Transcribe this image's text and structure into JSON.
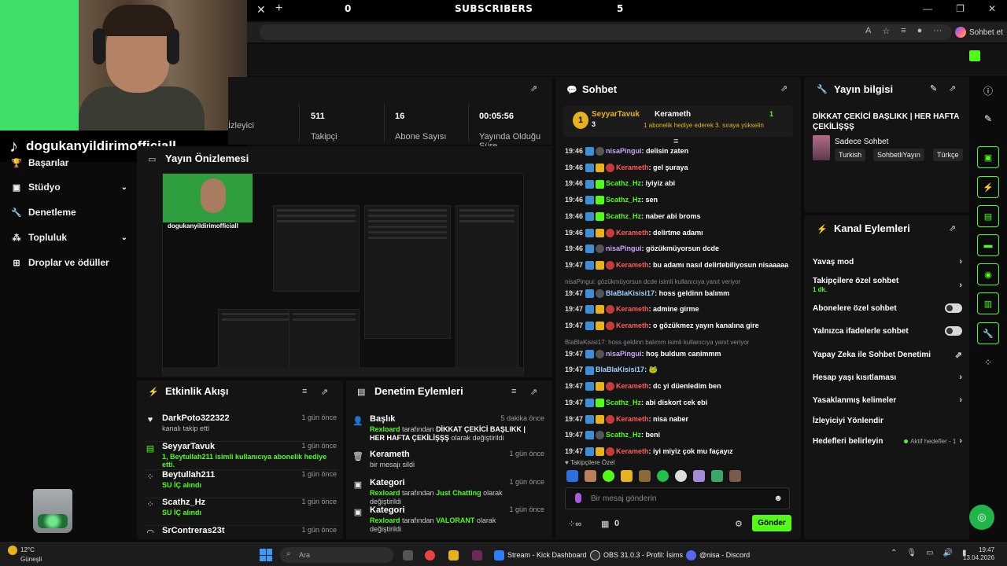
{
  "browser": {
    "close_glyph": "✕",
    "plus_glyph": "+",
    "bar_left_value": "0",
    "bar_title": "SUBSCRIBERS",
    "bar_right_value": "5",
    "controls": [
      "—",
      "❐",
      "✕"
    ],
    "copilot_label": "Sohbet et"
  },
  "webcam": {
    "handle": "dogukanyildirimofficiall"
  },
  "sidebar": {
    "items": [
      {
        "label": "Başarılar",
        "icon": "trophy-icon",
        "chevron": false
      },
      {
        "label": "Stüdyo",
        "icon": "studio-icon",
        "chevron": true
      },
      {
        "label": "Denetleme",
        "icon": "wrench-icon",
        "chevron": false
      },
      {
        "label": "Topluluk",
        "icon": "community-icon",
        "chevron": true
      },
      {
        "label": "Droplar ve ödüller",
        "icon": "gift-icon",
        "chevron": false
      }
    ]
  },
  "stats": {
    "cells": [
      {
        "value": "",
        "label": "İzleyici"
      },
      {
        "value": "511",
        "label": "Takipçi"
      },
      {
        "value": "16",
        "label": "Abone Sayısı"
      },
      {
        "value": "00:05:56",
        "label": "Yayında Olduğu Süre"
      }
    ]
  },
  "preview": {
    "title": "Yayın Önizlemesi",
    "inner_handle": "dogukanyildirimofficiall"
  },
  "activity": {
    "title": "Etkinlik Akışı",
    "items": [
      {
        "icon": "heart-icon",
        "name": "DarkPoto322322",
        "time": "1 gün önce",
        "sub": "kanalı takip etti",
        "sub_green": false
      },
      {
        "icon": "gift-icon",
        "name": "SeyyarTavuk",
        "time": "1 gün önce",
        "sub": "1, Beytullah211 isimli kullanıcıya abonelik hediye etti.",
        "sub_green": true
      },
      {
        "icon": "points-icon",
        "name": "Beytullah211",
        "time": "1 gün önce",
        "sub": "SU İÇ alındı",
        "sub_green": true
      },
      {
        "icon": "points-icon",
        "name": "Scathz_Hz",
        "time": "1 gün önce",
        "sub": "SU İÇ alındı",
        "sub_green": true
      },
      {
        "icon": "hat-icon",
        "name": "SrContreras23t",
        "time": "1 gün önce",
        "sub": "",
        "sub_green": false
      }
    ]
  },
  "moderation": {
    "title": "Denetim Eylemleri",
    "items": [
      {
        "icon": "user-edit-icon",
        "name": "Başlık",
        "time": "5 dakika önce",
        "by": "Rexloard",
        "mid": " tarafından ",
        "value": "DİKKAT ÇEKİCİ BAŞLIKK | HER HAFTA ÇEKİLİŞŞŞ",
        "tail": " olarak değiştirildi"
      },
      {
        "icon": "trash-icon",
        "name": "Kerameth",
        "time": "1 gün önce",
        "by": "",
        "mid": "bir mesajı sildi",
        "value": "",
        "tail": ""
      },
      {
        "icon": "category-icon",
        "name": "Kategori",
        "time": "1 gün önce",
        "by": "Rexloard",
        "mid": " tarafından ",
        "value": "Just Chatting",
        "tail": " olarak değiştirildi"
      },
      {
        "icon": "category-icon",
        "name": "Kategori",
        "time": "1 gün önce",
        "by": "Rexloard",
        "mid": " tarafından ",
        "value": "VALORANT",
        "tail": " olarak değiştirildi"
      }
    ]
  },
  "chat": {
    "title": "Sohbet",
    "pinned": {
      "user": "SeyyarTavuk",
      "count": "3",
      "mention": "Kerameth",
      "note": "1 abonelik hediye ederek 3. sıraya yükselin",
      "right_count": "1"
    },
    "messages": [
      {
        "time": "19:46",
        "badges": [
          "b1",
          "b4"
        ],
        "user": "nisaPingui",
        "color": "#c7a6ff",
        "text": "delisin zaten"
      },
      {
        "time": "19:46",
        "badges": [
          "b1",
          "b2",
          "b5"
        ],
        "user": "Kerameth",
        "color": "#ff5a5a",
        "text": "gel şuraya"
      },
      {
        "time": "19:46",
        "badges": [
          "b1",
          "b3"
        ],
        "user": "Scathz_Hz",
        "color": "#53fc18",
        "text": "iyiyiz abi"
      },
      {
        "time": "19:46",
        "badges": [
          "b1",
          "b3"
        ],
        "user": "Scathz_Hz",
        "color": "#53fc18",
        "text": "sen"
      },
      {
        "time": "19:46",
        "badges": [
          "b1",
          "b3"
        ],
        "user": "Scathz_Hz",
        "color": "#53fc18",
        "text": "naber abi broms"
      },
      {
        "time": "19:46",
        "badges": [
          "b1",
          "b2",
          "b5"
        ],
        "user": "Kerameth",
        "color": "#ff5a5a",
        "text": "delirtme adamı"
      },
      {
        "time": "19:46",
        "badges": [
          "b1",
          "b4"
        ],
        "user": "nisaPingui",
        "color": "#c7a6ff",
        "text": "gözükmüyorsun dcde"
      },
      {
        "time": "19:47",
        "badges": [
          "b1",
          "b2",
          "b5"
        ],
        "user": "Kerameth",
        "color": "#ff5a5a",
        "text": "bu adamı nasıl delirtebiliyosun nisaaaaa"
      },
      {
        "reply": "nisaPingui: gözükmüyorsun dcde isimli kullanıcıya yanıt veriyor"
      },
      {
        "time": "19:47",
        "badges": [
          "b1",
          "b4"
        ],
        "user": "BlaBlaKisisi17",
        "color": "#9fd0ff",
        "text": "hoss geldinn balımm"
      },
      {
        "time": "19:47",
        "badges": [
          "b1",
          "b2",
          "b5"
        ],
        "user": "Kerameth",
        "color": "#ff5a5a",
        "text": "admine girme"
      },
      {
        "time": "19:47",
        "badges": [
          "b1",
          "b2",
          "b5"
        ],
        "user": "Kerameth",
        "color": "#ff5a5a",
        "text": "o gözükmez yayın kanalına gire"
      },
      {
        "reply": "BlaBlaKisisi17: hoss geldinn balımm isimli kullanıcıya yanıt veriyor"
      },
      {
        "time": "19:47",
        "badges": [
          "b1",
          "b4"
        ],
        "user": "nisaPingui",
        "color": "#c7a6ff",
        "text": "hoş buldum canimmm"
      },
      {
        "time": "19:47",
        "badges": [
          "b1"
        ],
        "user": "BlaBlaKisisi17",
        "color": "#9fd0ff",
        "text": "🐸"
      },
      {
        "time": "19:47",
        "badges": [
          "b1",
          "b2",
          "b5"
        ],
        "user": "Kerameth",
        "color": "#ff5a5a",
        "text": "dc yi düenledim ben"
      },
      {
        "time": "19:47",
        "badges": [
          "b1",
          "b3"
        ],
        "user": "Scathz_Hz",
        "color": "#53fc18",
        "text": "abi diskort cek ebi"
      },
      {
        "time": "19:47",
        "badges": [
          "b1",
          "b2",
          "b5"
        ],
        "user": "Kerameth",
        "color": "#ff5a5a",
        "text": "nisa naber"
      },
      {
        "time": "19:47",
        "badges": [
          "b1",
          "b4"
        ],
        "user": "Scathz_Hz",
        "color": "#53fc18",
        "text": "beni"
      },
      {
        "time": "19:47",
        "badges": [
          "b1",
          "b2",
          "b5"
        ],
        "user": "Kerameth",
        "color": "#ff5a5a",
        "text": "iyi miyiz çok mu façayız"
      }
    ],
    "follow_only": "Takipçilere Özel",
    "input_placeholder": "Bir mesaj gönderin",
    "points_count": "0",
    "send_label": "Gönder"
  },
  "info": {
    "title": "Yayın bilgisi",
    "stream_title": "DİKKAT ÇEKİCİ BAŞLIKK | HER HAFTA ÇEKİLİŞŞŞ",
    "category": "Sadece Sohbet",
    "tags": [
      "Turkish",
      "SohbetliYayın",
      "Türkçe"
    ]
  },
  "actions": {
    "title": "Kanal Eylemleri",
    "slow_mode": "Yavaş mod",
    "followers_only": "Takipçilere özel sohbet",
    "followers_only_sub": "1 dk.",
    "subs_only": "Abonelere özel sohbet",
    "emotes_only": "Yalnızca ifadelerle sohbet",
    "ai_moderation": "Yapay Zeka ile Sohbet Denetimi",
    "age_restrict": "Hesap yaşı kısıtlaması",
    "banned_words": "Yasaklanmış kelimeler",
    "redirect": "İzleyiciyi Yönlendir",
    "goals": "Hedefleri belirleyin",
    "goals_active": "Aktif hedefler - 1"
  },
  "taskbar": {
    "temp": "12°C",
    "condition": "Güneşli",
    "search": "Ara",
    "apps": [
      {
        "label": "Stream - Kick Dashboard",
        "color": "#2b7fff"
      },
      {
        "label": "OBS 31.0.3 - Profil: İsims",
        "color": "#333"
      },
      {
        "label": "@nisa - Discord",
        "color": "#5865f2"
      }
    ],
    "time": "19:47",
    "date": "13.04.2026"
  },
  "colors": {
    "accent": "#53fc18",
    "panel": "#141414",
    "bg": "#0b0b0c"
  }
}
